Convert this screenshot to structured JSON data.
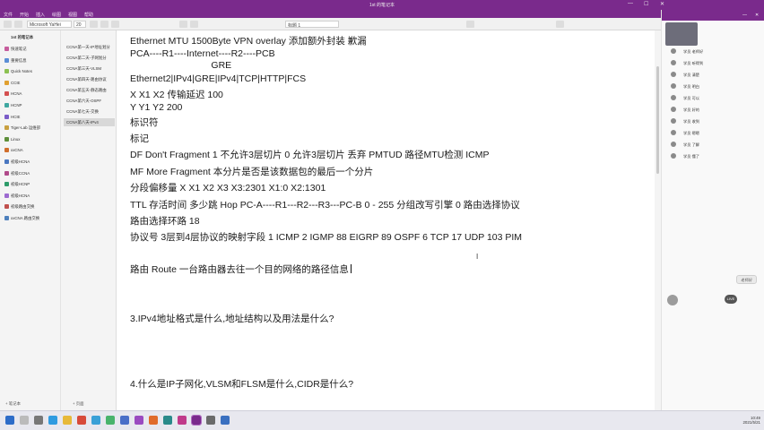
{
  "window": {
    "title": "1st 的笔记本"
  },
  "ribbon": {
    "tabs": [
      "文件",
      "开始",
      "插入",
      "绘图",
      "视图",
      "帮助"
    ],
    "font_box": "Microsoft YaHei",
    "size_box": "20",
    "style_box": "标题 1"
  },
  "sidebar": {
    "notebook_header": "1st 的笔记本",
    "notebooks": [
      {
        "label": "快速笔记",
        "color": "#c65c9d"
      },
      {
        "label": "重要信息",
        "color": "#5b8ed6"
      },
      {
        "label": "Quick Notes",
        "color": "#8cc152"
      },
      {
        "label": "CCIE",
        "color": "#e0a030"
      },
      {
        "label": "HCNA",
        "color": "#d45050"
      },
      {
        "label": "HCNP",
        "color": "#3fa7a0"
      },
      {
        "label": "HCIE",
        "color": "#7a5cc8"
      },
      {
        "label": "Tiger-Lab 运维部",
        "color": "#c8a040"
      },
      {
        "label": "Linux",
        "color": "#5e8f3a"
      },
      {
        "label": "xxCNA",
        "color": "#d06e2c"
      },
      {
        "label": "初级HCNA",
        "color": "#4a77c0"
      },
      {
        "label": "初级CCNA",
        "color": "#b04a8a"
      },
      {
        "label": "初级HCNP",
        "color": "#2e9c6a"
      },
      {
        "label": "初级HCNA",
        "color": "#9c6ad0"
      },
      {
        "label": "初级路由交换",
        "color": "#c0504d"
      },
      {
        "label": "xxCNA 路由交换",
        "color": "#4f81bd"
      }
    ],
    "sections": [
      {
        "label": "CCNA第一天-IP地址划分",
        "active": false
      },
      {
        "label": "CCNA第二天-子网划分",
        "active": false
      },
      {
        "label": "CCNA第三天-VLSM",
        "active": false
      },
      {
        "label": "CCNA第四天-路由协议",
        "active": false
      },
      {
        "label": "CCNA第五天-静态路由",
        "active": false
      },
      {
        "label": "CCNA第六天-OSPF",
        "active": false
      },
      {
        "label": "CCNA第七天-交换",
        "active": false
      },
      {
        "label": "CCNA第八天-IPv4",
        "active": true
      }
    ],
    "add_notebook": "+ 笔记本",
    "add_page": "+ 页面"
  },
  "note": {
    "lines": [
      "Ethernet MTU 1500Byte   VPN overlay 添加额外封装 歉漏",
      "PCA----R1----Internet----R2----PCB",
      "                               GRE",
      "Ethernet2|IPv4|GRE|IPv4|TCP|HTTP|FCS",
      "X X1 X2   传输延迟 100",
      "Y Y1 Y2    200",
      "标识符",
      "标记",
      "DF  Don't Fragment  1 不允许3层切片  0 允许3层切片 丢弃 PMTUD 路径MTU检测 ICMP",
      "MF More Fragment 本分片是否是该数据包的最后一个分片",
      "分段偏移量 X X1 X2 X3     X3:2301 X1:0 X2:1301",
      "TTL 存活时间 多少跳 Hop  PC-A----R1---R2---R3---PC-B  0 - 255 分组改写引擎 0 路由选择协议",
      "路由选择环路 18",
      "协议号 3层到4层协议的映射字段  1 ICMP 2 IGMP 88 EIGRP 89 OSPF 6 TCP 17 UDP 103 PIM",
      "路由 Route  一台路由器去往一个目的网络的路径信息",
      "3.IPv4地址格式是什么,地址结构以及用法是什么?",
      "4.什么是IP子网化,VLSM和FLSM是什么,CIDR是什么?"
    ]
  },
  "chat": {
    "messages": [
      {
        "name": "学员",
        "text": "老师好"
      },
      {
        "name": "学员",
        "text": "听得到"
      },
      {
        "name": "学员",
        "text": "清楚"
      },
      {
        "name": "学员",
        "text": "明白"
      },
      {
        "name": "学员",
        "text": "可以"
      },
      {
        "name": "学员",
        "text": "好的"
      },
      {
        "name": "学员",
        "text": "收到"
      },
      {
        "name": "学员",
        "text": "嗯嗯"
      },
      {
        "name": "学员",
        "text": "了解"
      },
      {
        "name": "学员",
        "text": "懂了"
      }
    ],
    "bubble": "老师好",
    "chip": "LIVE"
  },
  "taskbar": {
    "time": "10:49",
    "date": "2021/5/21"
  }
}
